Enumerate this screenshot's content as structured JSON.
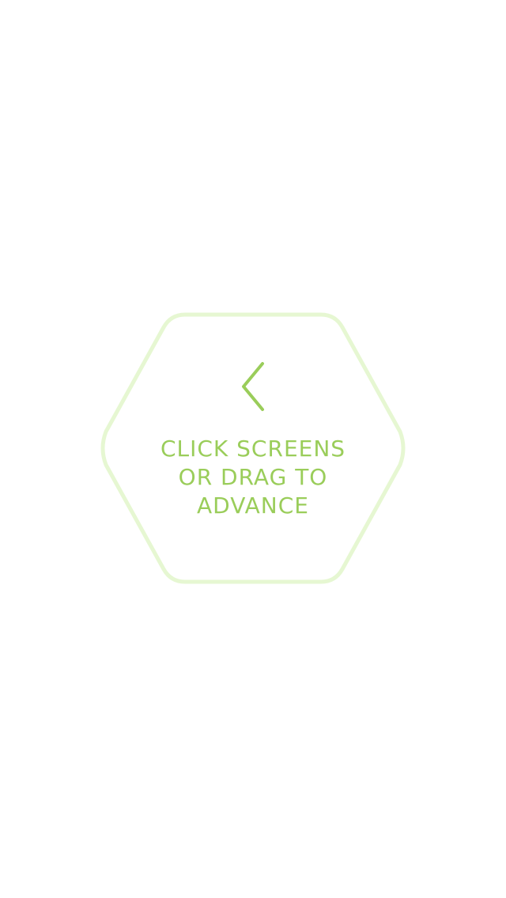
{
  "hint": {
    "lines": [
      "CLICK SCREENS",
      "OR DRAG TO",
      "ADVANCE"
    ],
    "icon": "chevron-left-icon",
    "accent_color": "#9acd5a",
    "outline_color": "#e6f7d2"
  }
}
